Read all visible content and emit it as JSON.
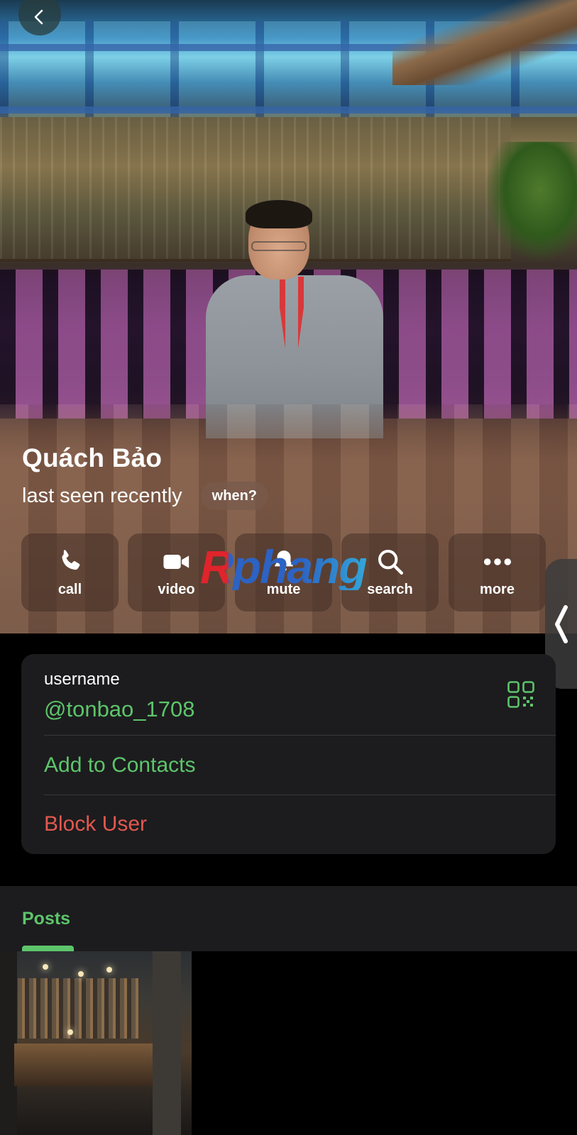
{
  "profile": {
    "name": "Quách Bảo",
    "status": "last seen recently",
    "when_label": "when?"
  },
  "actions": [
    {
      "label": "call",
      "icon": "phone-icon"
    },
    {
      "label": "video",
      "icon": "video-camera-icon"
    },
    {
      "label": "mute",
      "icon": "bell-icon"
    },
    {
      "label": "search",
      "icon": "search-icon"
    },
    {
      "label": "more",
      "icon": "more-dots-icon"
    }
  ],
  "watermark": "Rphang",
  "info": {
    "username_label": "username",
    "username_value": "@tonbao_1708",
    "add_contact": "Add to Contacts",
    "block_user": "Block User"
  },
  "tabs": {
    "posts": "Posts"
  },
  "colors": {
    "accent_green": "#5dc56b",
    "destructive_red": "#e2584f",
    "card_bg": "#1c1c1e"
  }
}
